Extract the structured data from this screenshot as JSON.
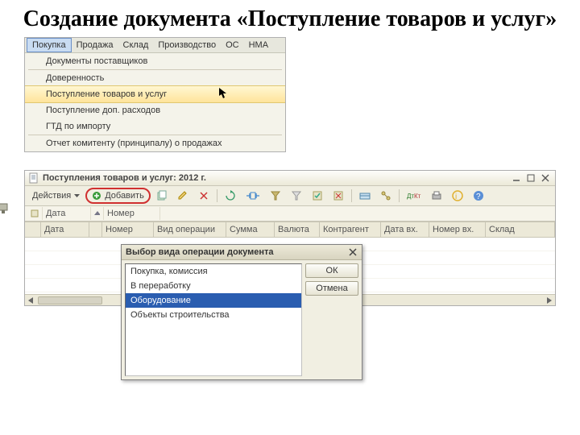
{
  "slide_title": "Создание документа «Поступление товаров и услуг»",
  "menubar": {
    "items": [
      "Покупка",
      "Продажа",
      "Склад",
      "Производство",
      "ОС",
      "НМА"
    ],
    "active_index": 0
  },
  "menu": {
    "items": [
      "Документы поставщиков",
      "Доверенность",
      "Поступление товаров и услуг",
      "Поступление доп. расходов",
      "ГТД по импорту",
      "Отчет комитенту (принципалу) о продажах"
    ],
    "highlight_index": 2
  },
  "listwin": {
    "title": "Поступления товаров и услуг: 2012 г.",
    "actions_label": "Действия",
    "add_label": "Добавить",
    "columns": [
      "",
      "Дата",
      "",
      "Номер",
      "Вид операции",
      "Сумма",
      "Валюта",
      "Контрагент",
      "Дата вх.",
      "Номер вх.",
      "Склад"
    ]
  },
  "dialog": {
    "title": "Выбор вида операции документа",
    "options": [
      "Покупка, комиссия",
      "В переработку",
      "Оборудование",
      "Объекты строительства"
    ],
    "selected_index": 2,
    "ok_label": "ОК",
    "cancel_label": "Отмена"
  }
}
